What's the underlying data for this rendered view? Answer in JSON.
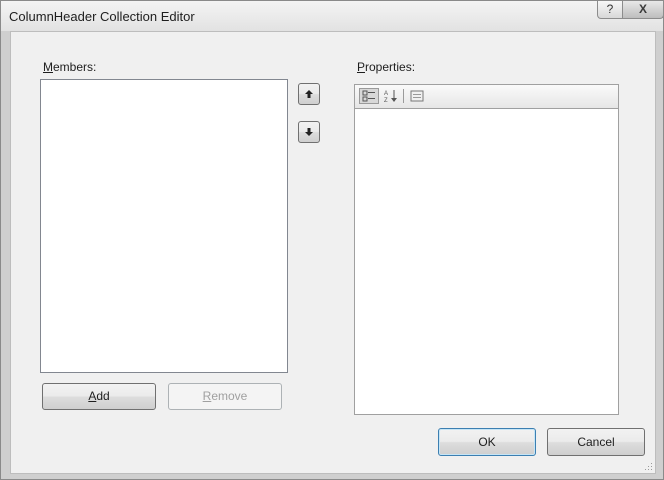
{
  "window": {
    "title": "ColumnHeader Collection Editor",
    "help_glyph": "?",
    "close_glyph": "X"
  },
  "members": {
    "label_accel": "M",
    "label_rest": "embers:",
    "items": []
  },
  "properties": {
    "label_accel": "P",
    "label_rest": "roperties:",
    "toolbar_icons": [
      "categorized-icon",
      "alphabetical-icon",
      "property-pages-icon"
    ]
  },
  "buttons": {
    "move_up_glyph": "🡅",
    "move_down_glyph": "🡇",
    "add_accel": "A",
    "add_rest": "dd",
    "remove_accel": "R",
    "remove_rest": "emove",
    "ok": "OK",
    "cancel": "Cancel"
  },
  "colors": {
    "client_bg": "#f0f0f0",
    "default_button_border": "#3c7fb1"
  }
}
